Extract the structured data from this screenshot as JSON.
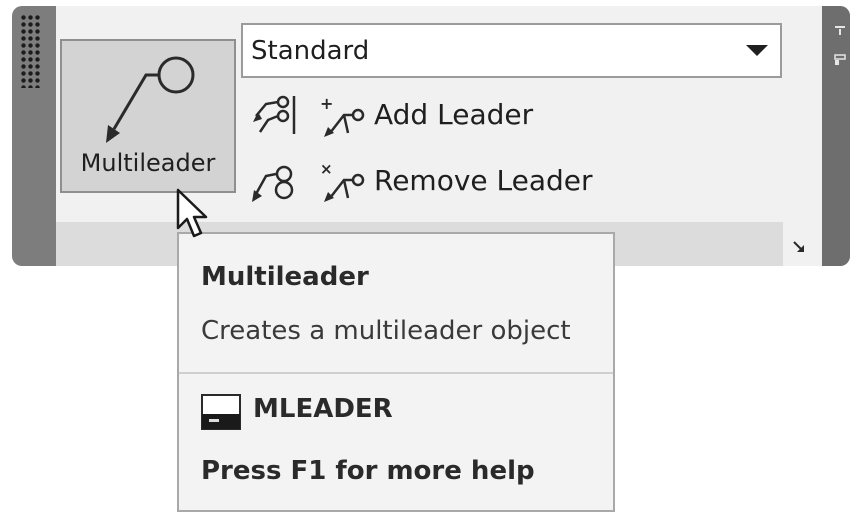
{
  "panel": {
    "big_button_label": "Multileader",
    "style_dropdown": {
      "selected": "Standard"
    },
    "rows": [
      {
        "label": "Add Leader"
      },
      {
        "label": "Remove Leader"
      }
    ]
  },
  "tooltip": {
    "title": "Multileader",
    "description": "Creates a multileader object",
    "command": "MLEADER",
    "help": "Press F1 for more help"
  },
  "icons": {
    "big_button": "multileader-icon",
    "dropdown": "chevron-down-icon",
    "align": "align-multileaders-icon",
    "collect": "collect-multileaders-icon",
    "add": "add-leader-icon",
    "remove": "remove-leader-icon",
    "command": "command-line-icon",
    "launcher": "dialog-launcher-icon",
    "cursor": "mouse-pointer-icon"
  }
}
